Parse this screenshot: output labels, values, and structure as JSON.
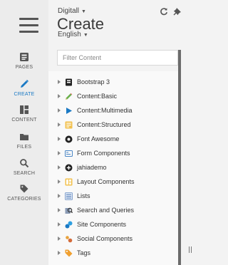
{
  "header": {
    "site": "Digitall",
    "title": "Create",
    "language": "English",
    "refresh_icon": "refresh-icon",
    "pin_icon": "pin-icon"
  },
  "nav": {
    "menu_icon": "hamburger-menu-icon",
    "items": [
      {
        "label": "PAGES",
        "icon": "pages-icon"
      },
      {
        "label": "CREATE",
        "icon": "pencil-icon",
        "active": true
      },
      {
        "label": "CONTENT",
        "icon": "content-grid-icon"
      },
      {
        "label": "FILES",
        "icon": "folder-icon"
      },
      {
        "label": "SEARCH",
        "icon": "search-icon"
      },
      {
        "label": "CATEGORIES",
        "icon": "tag-icon"
      }
    ]
  },
  "filter": {
    "placeholder": "Filter Content",
    "value": ""
  },
  "tree": [
    {
      "label": "Bootstrap 3",
      "icon": "bootstrap-icon"
    },
    {
      "label": "Content:Basic",
      "icon": "pencil-green-icon"
    },
    {
      "label": "Content:Multimedia",
      "icon": "play-icon"
    },
    {
      "label": "Content:Structured",
      "icon": "structured-doc-icon"
    },
    {
      "label": "Font Awesome",
      "icon": "font-awesome-icon"
    },
    {
      "label": "Form Components",
      "icon": "form-icon"
    },
    {
      "label": "jahiademo",
      "icon": "plus-circle-icon"
    },
    {
      "label": "Layout Components",
      "icon": "layout-icon"
    },
    {
      "label": "Lists",
      "icon": "list-icon"
    },
    {
      "label": "Search and Queries",
      "icon": "search-queries-icon"
    },
    {
      "label": "Site Components",
      "icon": "site-components-icon"
    },
    {
      "label": "Social Components",
      "icon": "social-icon"
    },
    {
      "label": "Tags",
      "icon": "tags-icon"
    }
  ],
  "colors": {
    "accent": "#1a79c4",
    "scrollbar": "#6b6b6b"
  }
}
